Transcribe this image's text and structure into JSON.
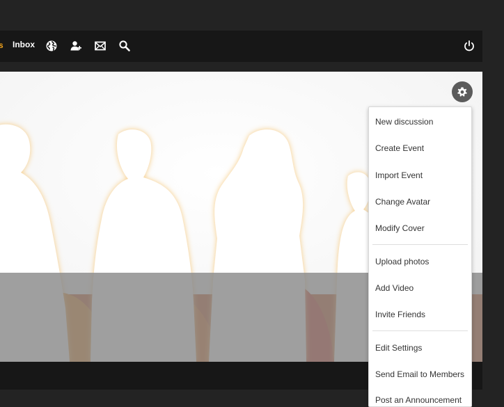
{
  "topnav": {
    "partial_label": "s",
    "inbox_label": "Inbox",
    "icons": [
      "globe-icon",
      "friends-icon",
      "mail-icon",
      "search-icon",
      "power-icon"
    ]
  },
  "cover": {
    "description_colors": {
      "overlay": "#8a8a8a",
      "accent_orange": "#e07a10",
      "accent_red": "#c72a12"
    }
  },
  "settings_menu": {
    "button_icon": "gear-icon",
    "items": [
      {
        "label": "New discussion"
      },
      {
        "label": "Create Event"
      },
      {
        "label": "Import Event"
      },
      {
        "label": "Change Avatar"
      },
      {
        "label": "Modify Cover"
      },
      {
        "label": "Upload photos"
      },
      {
        "label": "Add Video"
      },
      {
        "label": "Invite Friends"
      },
      {
        "label": "Edit Settings"
      },
      {
        "label": "Send Email to Members"
      },
      {
        "label": "Post an Announcement"
      }
    ]
  }
}
